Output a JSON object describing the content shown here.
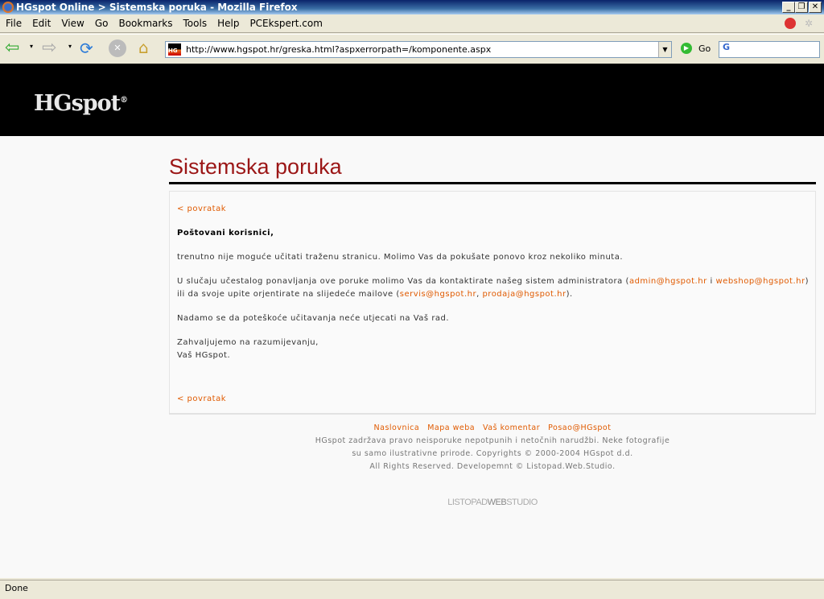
{
  "window": {
    "title": "HGspot Online > Sistemska poruka - Mozilla Firefox"
  },
  "menu": [
    "File",
    "Edit",
    "View",
    "Go",
    "Bookmarks",
    "Tools",
    "Help",
    "PCEkspert.com"
  ],
  "nav": {
    "url": "http://www.hgspot.hr/greska.html?aspxerrorpath=/komponente.aspx",
    "go_label": "Go"
  },
  "site": {
    "logo": "HGspot"
  },
  "main": {
    "title": "Sistemska poruka",
    "back": "< povratak",
    "greeting": "Poštovani korisnici,",
    "p1": "trenutno nije moguće učitati traženu stranicu. Molimo Vas da pokušate ponovo kroz nekoliko minuta.",
    "p2a": "U slučaju učestalog ponavljanja ove poruke molimo Vas da kontaktirate našeg sistem administratora (",
    "email1": "admin@hgspot.hr",
    "p2b": " i ",
    "email2": "webshop@hgspot.hr",
    "p2c": ") ili da svoje upite orjentirate na slijedeće mailove (",
    "email3": "servis@hgspot.hr",
    "p2d": ", ",
    "email4": "prodaja@hgspot.hr",
    "p2e": ").",
    "p3": "Nadamo se da poteškoće učitavanja neće utjecati na Vaš rad.",
    "thanks": "Zahvaljujemo na razumijevanju,",
    "sign": "Vaš HGspot."
  },
  "footer": {
    "links": [
      "Naslovnica",
      "Mapa weba",
      "Vaš komentar",
      "Posao@HGspot"
    ],
    "line1": "HGspot zadržava pravo neisporuke nepotpunih i netočnih narudžbi. Neke fotografije",
    "line2": "su samo ilustrativne prirode. Copyrights © 2000-2004 HGspot d.d.",
    "line3": "All Rights Reserved. Developemnt © Listopad.Web.Studio.",
    "studio_a": "LISTOPAD",
    "studio_b": "WEB",
    "studio_c": "STUDIO"
  },
  "status": "Done"
}
